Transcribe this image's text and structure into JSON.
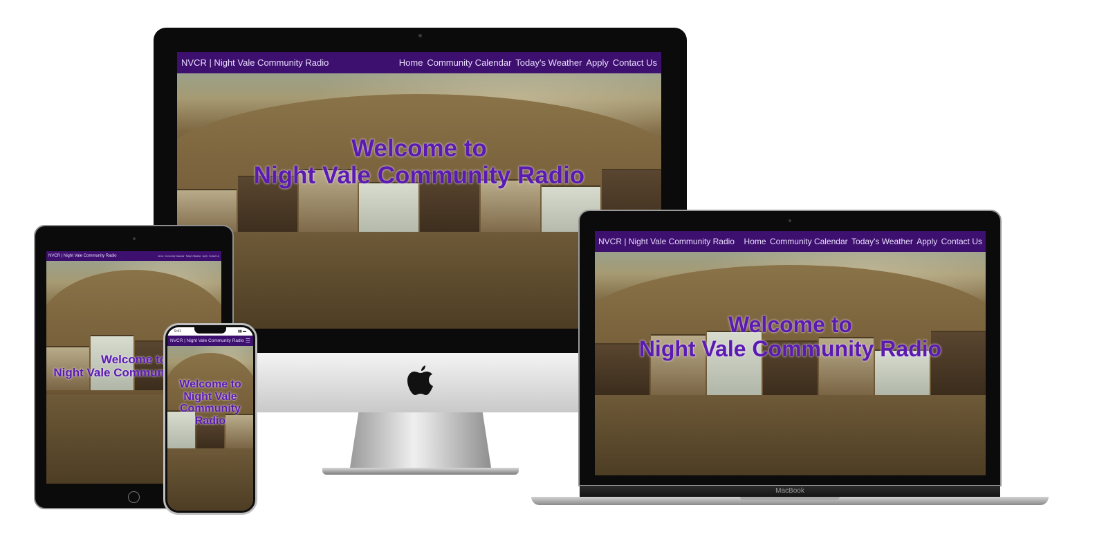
{
  "site": {
    "brand": "NVCR | Night Vale Community Radio",
    "nav": [
      "Home",
      "Community Calendar",
      "Today's Weather",
      "Apply",
      "Contact Us"
    ],
    "welcome_line1": "Welcome to",
    "welcome_line2": "Night Vale Community Radio",
    "mobile_welcome": [
      "Welcome to",
      "Night Vale",
      "Community",
      "Radio"
    ],
    "menu_icon": "hamburger-menu-icon"
  },
  "devices": {
    "laptop_label": "MacBook",
    "phone_time": "9:41"
  },
  "colors": {
    "nav_bg": "#3d0f6e",
    "heading": "#5b1bb0",
    "nav_text": "#e9dcff"
  }
}
